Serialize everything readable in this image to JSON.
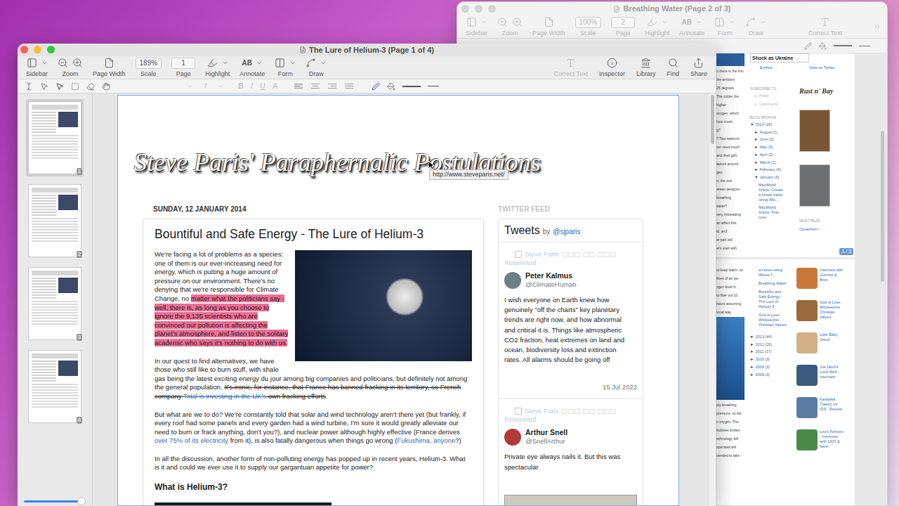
{
  "back_window": {
    "title": "Breathing Water (Page 2 of 3)",
    "active": false,
    "toolbar": {
      "left": [
        {
          "label": "Sidebar",
          "kind": "icon"
        },
        {
          "label": "Zoom",
          "kind": "icon"
        },
        {
          "label": "Page Width",
          "kind": "icon"
        },
        {
          "label": "Scale",
          "kind": "field",
          "value": "100%"
        },
        {
          "label": "Page",
          "kind": "field",
          "value": "2"
        },
        {
          "label": "Highlight",
          "kind": "icon"
        },
        {
          "label": "Annotate",
          "kind": "text",
          "value": "AB"
        },
        {
          "label": "Form",
          "kind": "icon"
        },
        {
          "label": "Draw",
          "kind": "icon"
        }
      ],
      "right": [
        {
          "label": "Correct Text",
          "kind": "icon",
          "disabled": true
        }
      ]
    },
    "first_page": {
      "fragments": [
        "n there in the first",
        "the ambient",
        "25 degrees",
        "The colder the",
        "higher",
        "oxygen, which",
        "how much",
        "g?",
        "? Two reasons:",
        "ver need much",
        "and their gills",
        "apture around",
        "gen.",
        "n, the one",
        "orean designer,",
        "breathing",
        "water?",
        "very misleading",
        "an affect this,",
        "ld, and",
        "er part will",
        "et's start with"
      ],
      "headline": "Shock as Ukraine",
      "links": [
        "Embed",
        "View on Twitter"
      ],
      "subscribe": {
        "title": "SUBSCRIBE TO",
        "items": [
          "Posts",
          "Comments"
        ]
      },
      "logo": "Rust n' Bay",
      "archive": {
        "title": "BLOG ARCHIVE",
        "year": {
          "marker": "▼",
          "label": "2014 (18)"
        },
        "months": [
          {
            "marker": "►",
            "label": "August (1)"
          },
          {
            "marker": "►",
            "label": "June (2)"
          },
          {
            "marker": "►",
            "label": "May (3)"
          },
          {
            "marker": "►",
            "label": "April (2)"
          },
          {
            "marker": "►",
            "label": "March (1)"
          },
          {
            "marker": "►",
            "label": "February (4)"
          },
          {
            "marker": "▼",
            "label": "January (5)"
          }
        ],
        "articles": [
          "MacWorld Article: Create a movie trailer using iMo...",
          "MacWorld Article: Fine tune"
        ]
      },
      "covers": [
        {
          "color": "#7a5634"
        },
        {
          "color": "#6d6f73"
        }
      ],
      "most_read": {
        "title": "MOST READ",
        "items": [
          "Oceanhorn -"
        ]
      },
      "badge": "1 / 3"
    },
    "second_page": {
      "fragments": [
        "to keep warm, so",
        "litres of air per",
        "ygen level in",
        "to filter out 10",
        "hours assuming",
        "ional way.",
        "ply breathing",
        "pressure, so the",
        "n oxygen. The",
        "bubbles limited",
        "echnology will",
        "operated will",
        "needed to take"
      ],
      "articles": [
        "a movie using iMovie f..."
      ],
      "posts": [
        "Breathing Water",
        "Bountiful and Safe Energy - The Lure of Helium-3",
        "God is Love: Wholesome Christian Values"
      ],
      "years": [
        {
          "marker": "►",
          "label": "2013 (44)"
        },
        {
          "marker": "►",
          "label": "2012 (26)"
        },
        {
          "marker": "►",
          "label": "2011 (17)"
        },
        {
          "marker": "►",
          "label": "2010 (3)"
        },
        {
          "marker": "►",
          "label": "2009 (3)"
        },
        {
          "marker": "►",
          "label": "2008 (3)"
        }
      ],
      "most_read": [
        {
          "caption": "Interview with Cornfox & Bros",
          "color": "#c9783a"
        },
        {
          "caption": "God is Love: Wholesome Christian Values",
          "color": "#9a6a3c"
        },
        {
          "caption": "Little Baby Jesus",
          "color": "#d3b088"
        },
        {
          "caption": "Joe Devil's Lone Wolf - Interview",
          "color": "#3b5a7c"
        },
        {
          "caption": "Karateka Classic for iOS - Review",
          "color": "#5a7ca2"
        },
        {
          "caption": "Leo's Fortune - Interview with 1337 & Senri",
          "color": "#4c8a4a"
        }
      ]
    }
  },
  "front_window": {
    "title": "The Lure of Helium-3 (Page 1 of 4)",
    "active": true,
    "toolbar": {
      "left": [
        {
          "label": "Sidebar",
          "kind": "icon"
        },
        {
          "label": "Zoom",
          "kind": "icon"
        },
        {
          "label": "Page Width",
          "kind": "icon"
        },
        {
          "label": "Scale",
          "kind": "field",
          "value": "189%"
        },
        {
          "label": "Page",
          "kind": "field",
          "value": "1"
        },
        {
          "label": "Highlight",
          "kind": "icon"
        },
        {
          "label": "Annotate",
          "kind": "text",
          "value": "AB"
        },
        {
          "label": "Form",
          "kind": "icon"
        },
        {
          "label": "Draw",
          "kind": "icon"
        }
      ],
      "right": [
        {
          "label": "Correct Text",
          "kind": "icon",
          "disabled": true
        },
        {
          "label": "Inspector",
          "kind": "icon",
          "disabled": false
        },
        {
          "label": "Library",
          "kind": "icon",
          "disabled": false
        },
        {
          "label": "Find",
          "kind": "icon",
          "disabled": false
        },
        {
          "label": "Share",
          "kind": "icon",
          "disabled": false
        }
      ]
    },
    "format_bar": {
      "font_size": "7",
      "styles": [
        "B",
        "I",
        "U",
        "A"
      ],
      "styles_disabled": true
    },
    "thumbnails": [
      {
        "page": "1",
        "selected": true
      },
      {
        "page": "2",
        "selected": false
      },
      {
        "page": "3",
        "selected": false
      },
      {
        "page": "4",
        "selected": false
      }
    ],
    "thumbnail_size": {
      "level": 0.93
    },
    "document": {
      "blog_title": "Steve Paris' Paraphernalic Postulations",
      "link_tooltip": "http://www.steveparis.net/",
      "date": "SUNDAY, 12 JANUARY 2014",
      "post": {
        "title": "Bountiful and Safe Energy - The Lure of Helium-3",
        "paragraphs": [
          [
            {
              "text": "We're facing a lot of problems as a species: one of them is our ever-increasing need for energy, which is putting a huge amount of pressure on our environment. There's no denying that we're responsible for Climate Change, no ",
              "kind": "plain"
            },
            {
              "text": "matter what the politicians say - well, there is, as long as you choose to ignore the 9,135 scientists who are convinced our pollution is affecting the planet's atmosphere, and listen to the solitary academic who says it's nothing to do with us.",
              "kind": "highlight"
            }
          ],
          [
            {
              "text": "In our quest to find alternatives, we have those who still like to burn stuff, with shale gas being the latest exciting energy du jour among big companies and politicians, but definitely not among the general population. ",
              "kind": "plain"
            },
            {
              "text": "It's ironic, for instance, that France has banned fracking in its territory, so French company ",
              "kind": "strike"
            },
            {
              "text": "Total is investing in the UK's",
              "kind": "link-strike"
            },
            {
              "text": " own fracking efforts",
              "kind": "strike"
            },
            {
              "text": ".",
              "kind": "plain"
            }
          ],
          [
            {
              "text": "But what are we to do? We're constantly told that solar and wind technology aren't there yet (but frankly, if every roof had some panels and every garden had a wind turbine, I'm sure it would greatly alleviate our need to burn or frack anything, don't you?), and nuclear power although highly effective (France derives ",
              "kind": "plain"
            },
            {
              "text": "over 75% of its electricity",
              "kind": "link"
            },
            {
              "text": " from it), is also fatally dangerous when things go wrong (",
              "kind": "plain"
            },
            {
              "text": "Fukushima, anyone",
              "kind": "link"
            },
            {
              "text": "?)",
              "kind": "plain"
            }
          ],
          [
            {
              "text": "In all the discussion, another form of non-polluting energy has popped up in recent years, Helium-3. What is it and could we ever use it to supply our gargantuan appetite for power?",
              "kind": "plain"
            }
          ]
        ],
        "heading": "What is Helium-3?"
      },
      "twitter": {
        "section_title": "TWITTER FEED",
        "title": "Tweets",
        "by": "by",
        "handle": "@sjparis",
        "tweets": [
          {
            "retweeter": "Steve Paris",
            "glyphs": "□□□ □□ □□□",
            "retweeted": "Retweeted",
            "name": "Peter Kalmus",
            "handle": "@ClimateHuman",
            "color": "#6b7f86",
            "text": "I wish everyone on Earth knew how genuinely \"off the charts\" key planetary trends are right now, and how abnormal and critical it is. Things like atmospheric CO2 fraction, heat extremes on land and ocean, biodiversity loss and extinction rates. All alarms should be going off",
            "date": "15 Jul 2022",
            "has_image": false
          },
          {
            "retweeter": "Steve Paris",
            "glyphs": "□□□ □□ □□□",
            "retweeted": "Retweeted",
            "name": "Arthur Snell",
            "handle": "@SnellArthur",
            "color": "#b23a3a",
            "text": "Private eye always nails it. But this was spectacular",
            "date": "",
            "has_image": true
          }
        ]
      }
    }
  }
}
